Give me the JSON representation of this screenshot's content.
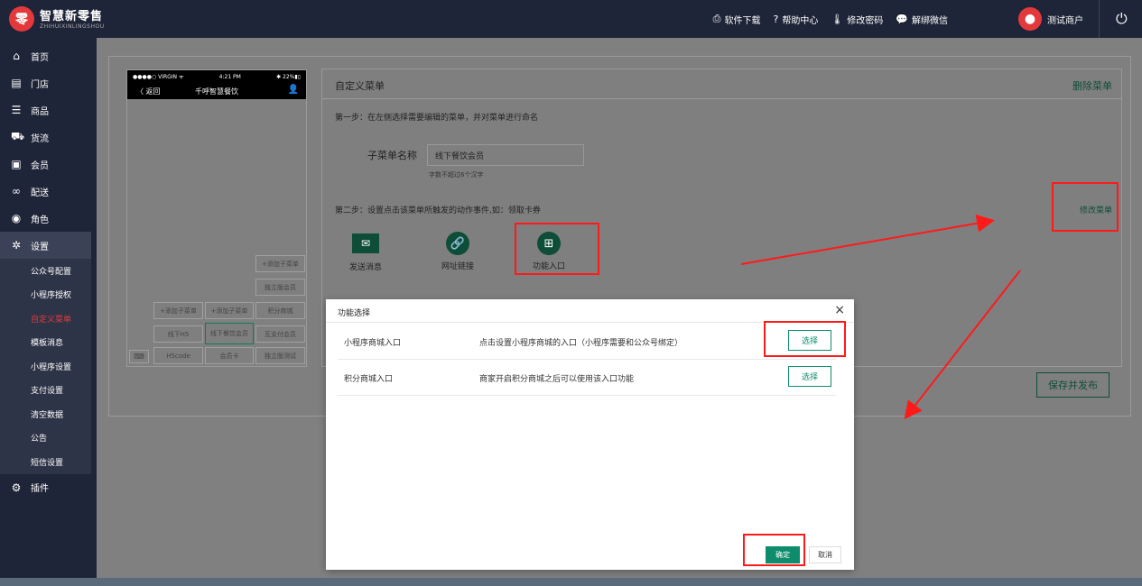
{
  "header": {
    "logo_char": "零",
    "brand_cn": "智慧新零售",
    "brand_en": "ZHIHUIXINLINGSHOU",
    "nav": [
      {
        "icon": "⎙",
        "label": "软件下载"
      },
      {
        "icon": "?",
        "label": "帮助中心"
      },
      {
        "icon": "🌡",
        "label": "修改密码"
      },
      {
        "icon": "💬",
        "label": "解绑微信"
      }
    ],
    "user_name": "测试商户",
    "power_icon": "⏻"
  },
  "sidebar": {
    "items": [
      {
        "icon": "⌂",
        "label": "首页"
      },
      {
        "icon": "▤",
        "label": "门店"
      },
      {
        "icon": "☰",
        "label": "商品"
      },
      {
        "icon": "⛟",
        "label": "货流"
      },
      {
        "icon": "▣",
        "label": "会员"
      },
      {
        "icon": "∞",
        "label": "配送"
      },
      {
        "icon": "◉",
        "label": "角色"
      },
      {
        "icon": "✲",
        "label": "设置"
      }
    ],
    "sub_items": [
      "公众号配置",
      "小程序授权",
      "自定义菜单",
      "模板消息",
      "小程序设置",
      "支付设置",
      "清空数据",
      "公告",
      "短信设置"
    ],
    "current_sub": "自定义菜单",
    "plugin": {
      "icon": "⚙",
      "label": "插件"
    }
  },
  "phone": {
    "carrier": "●●●●○ VIRGIN ᯤ",
    "time": "4:21 PM",
    "battery": "✱ 22%▮▯",
    "back": "〈 返回",
    "title": "千呼智慧餐饮",
    "user_icon": "👤",
    "col3": [
      "+添加子菜单",
      "独立版会员",
      "积分商城",
      "互支付会员",
      "独立版测试"
    ],
    "col1": [
      "+添加子菜单",
      "线下H5",
      "H5code"
    ],
    "col2": [
      "+添加子菜单",
      "线下餐饮会员",
      "会员卡"
    ],
    "keyboard_icon": "⌨"
  },
  "edit": {
    "title": "自定义菜单",
    "delete_label": "删除菜单",
    "step1": "第一步：在左侧选择需要编辑的菜单，并对菜单进行命名",
    "name_label": "子菜单名称",
    "name_value": "线下餐饮会员",
    "name_hint": "字数不超过6个汉字",
    "step2": "第二步：设置点击该菜单所触发的动作事件,如：领取卡券",
    "modify_label": "修改菜单",
    "actions": [
      {
        "icon": "✉",
        "label": "发送消息"
      },
      {
        "icon": "🔗",
        "label": "网址链接"
      },
      {
        "icon": "⊞",
        "label": "功能入口"
      }
    ]
  },
  "save_label": "保存并发布",
  "modal": {
    "title": "功能选择",
    "close": "×",
    "rows": [
      {
        "name": "小程序商城入口",
        "desc": "点击设置小程序商城的入口（小程序需要和公众号绑定）",
        "button": "选择"
      },
      {
        "name": "积分商城入口",
        "desc": "商家开启积分商城之后可以使用该入口功能",
        "button": "选择"
      }
    ],
    "ok_label": "确定",
    "cancel_label": "取消"
  },
  "colors": {
    "accent": "#0e8d6c",
    "annotation": "#ff1a1a",
    "sidebar": "#1f2538",
    "brand": "#e4393c"
  }
}
